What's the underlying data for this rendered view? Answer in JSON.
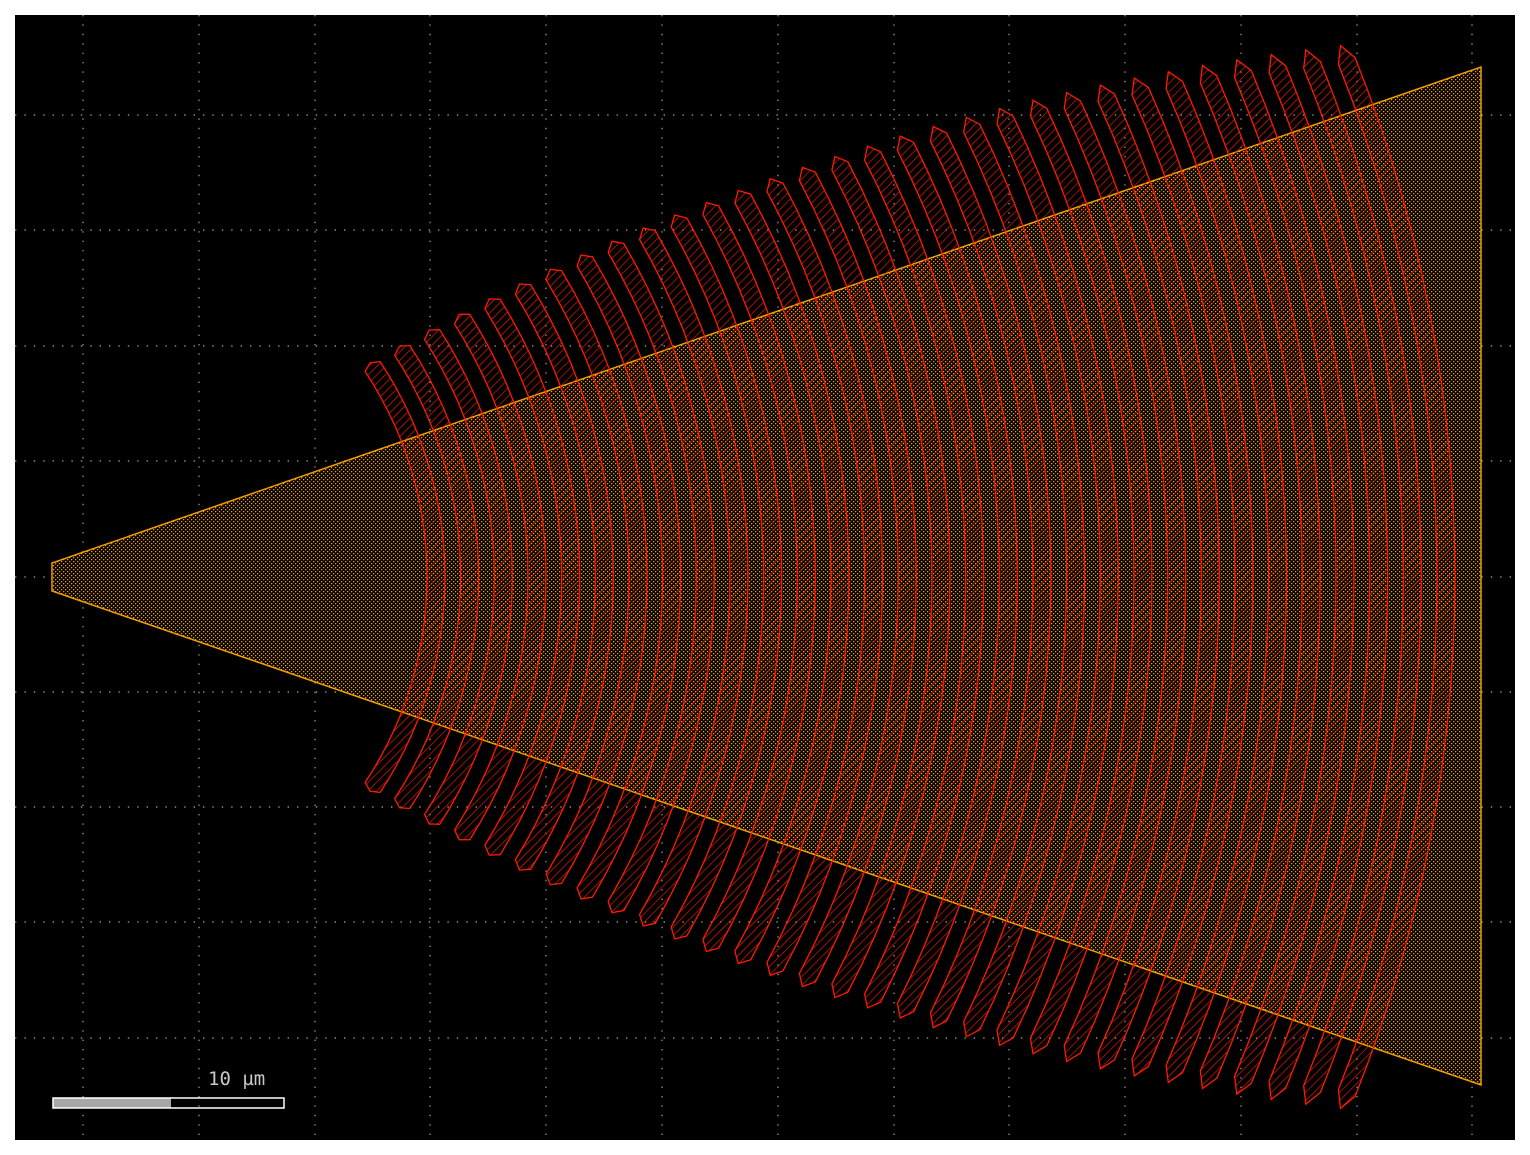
{
  "viewer": {
    "background": "#000000",
    "grid_color": "#8a8a8a",
    "grid": true
  },
  "layers": {
    "taper": {
      "name": "taper-layer",
      "color": "#f5a000"
    },
    "grating": {
      "name": "grating-layer",
      "color": "#ff1a00"
    }
  },
  "grating": {
    "teeth_count": 31
  },
  "scale_bar": {
    "label": "10 µm",
    "value_um": 10,
    "bar_fill": "#a8a8a8",
    "bar_border": "#ffffff"
  }
}
